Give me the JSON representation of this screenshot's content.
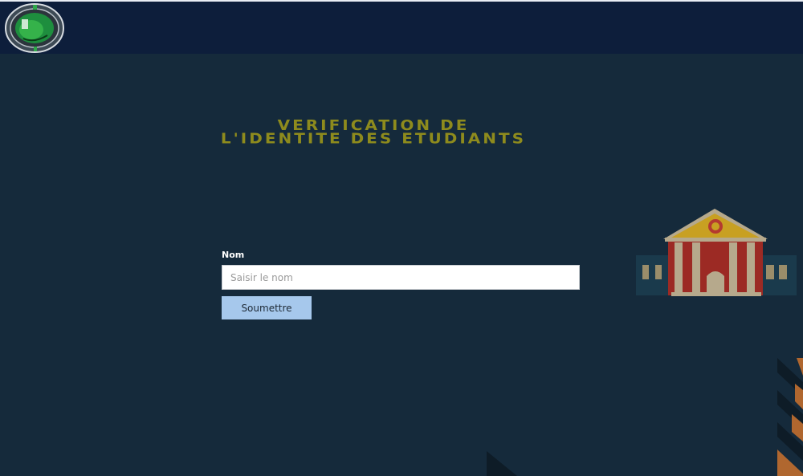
{
  "header": {
    "logo_icon": "university-seal-logo"
  },
  "title": {
    "line1": "VERIFICATION DE",
    "line2": "L'IDENTITE DES ETUDIANTS"
  },
  "form": {
    "name_label": "Nom",
    "name_placeholder": "Saisir le nom",
    "name_value": "",
    "submit_label": "Soumettre"
  },
  "decorations": {
    "building_icon": "university-building-icon",
    "stripes_icon": "diagonal-stripes-decoration"
  },
  "colors": {
    "background": "#152a3b",
    "header": "#0d1e3b",
    "title": "#8e8b1d",
    "button": "#a6c8ec"
  }
}
